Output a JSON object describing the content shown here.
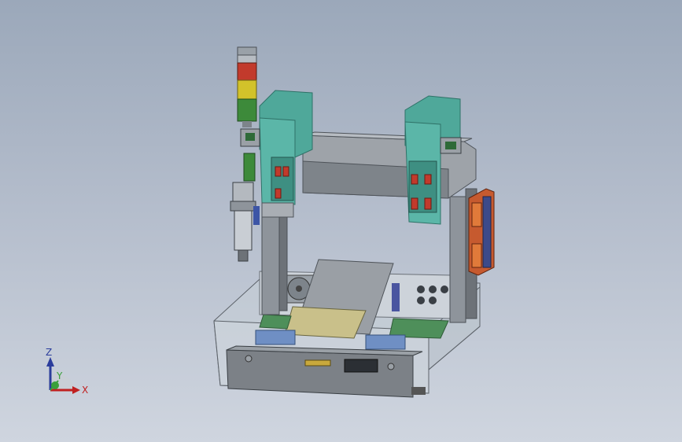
{
  "viewport": {
    "background_top": "#9ba8ba",
    "background_bottom": "#cfd5df"
  },
  "model": {
    "colors": {
      "frame": "#8e949b",
      "frame_dark": "#5b6066",
      "teal": "#4fa89a",
      "teal_dark": "#2f7268",
      "red": "#c23a2c",
      "yellow": "#d2c22a",
      "green": "#3d8a3a",
      "pcb": "#4e8f5a",
      "blue": "#4b6fa8",
      "glass": "#c8d0d8"
    },
    "tower_light": [
      "red",
      "yellow",
      "green"
    ],
    "front_panel_display": "display"
  },
  "triad": {
    "z_label": "Z",
    "y_label": "Y",
    "x_label": "X",
    "z_color": "#2b3d9c",
    "x_color": "#c02020",
    "y_color": "#3aa03a"
  }
}
